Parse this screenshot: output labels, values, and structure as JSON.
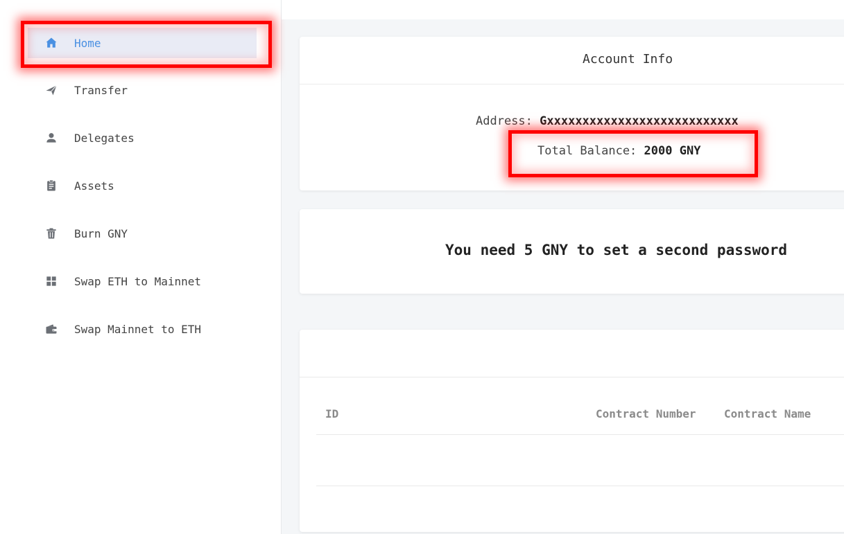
{
  "sidebar": {
    "items": [
      {
        "label": "Home",
        "icon": "home-icon",
        "active": true
      },
      {
        "label": "Transfer",
        "icon": "send-icon"
      },
      {
        "label": "Delegates",
        "icon": "person-icon"
      },
      {
        "label": "Assets",
        "icon": "clipboard-icon"
      },
      {
        "label": "Burn GNY",
        "icon": "trash-icon"
      },
      {
        "label": "Swap ETH to Mainnet",
        "icon": "grid-icon"
      },
      {
        "label": "Swap Mainnet to ETH",
        "icon": "wallet-icon"
      }
    ],
    "active_color": "#4a90e2"
  },
  "account": {
    "title": "Account Info",
    "address_label": "Address:",
    "address_value": "Gxxxxxxxxxxxxxxxxxxxxxxxxxxx",
    "balance_label": "Total Balance:",
    "balance_value": "2000 GNY"
  },
  "notice": {
    "text": "You need 5 GNY to set a second password"
  },
  "table": {
    "headers": [
      "ID",
      "Contract Number",
      "Contract Name"
    ]
  },
  "colors": {
    "highlight": "#ff0000"
  }
}
